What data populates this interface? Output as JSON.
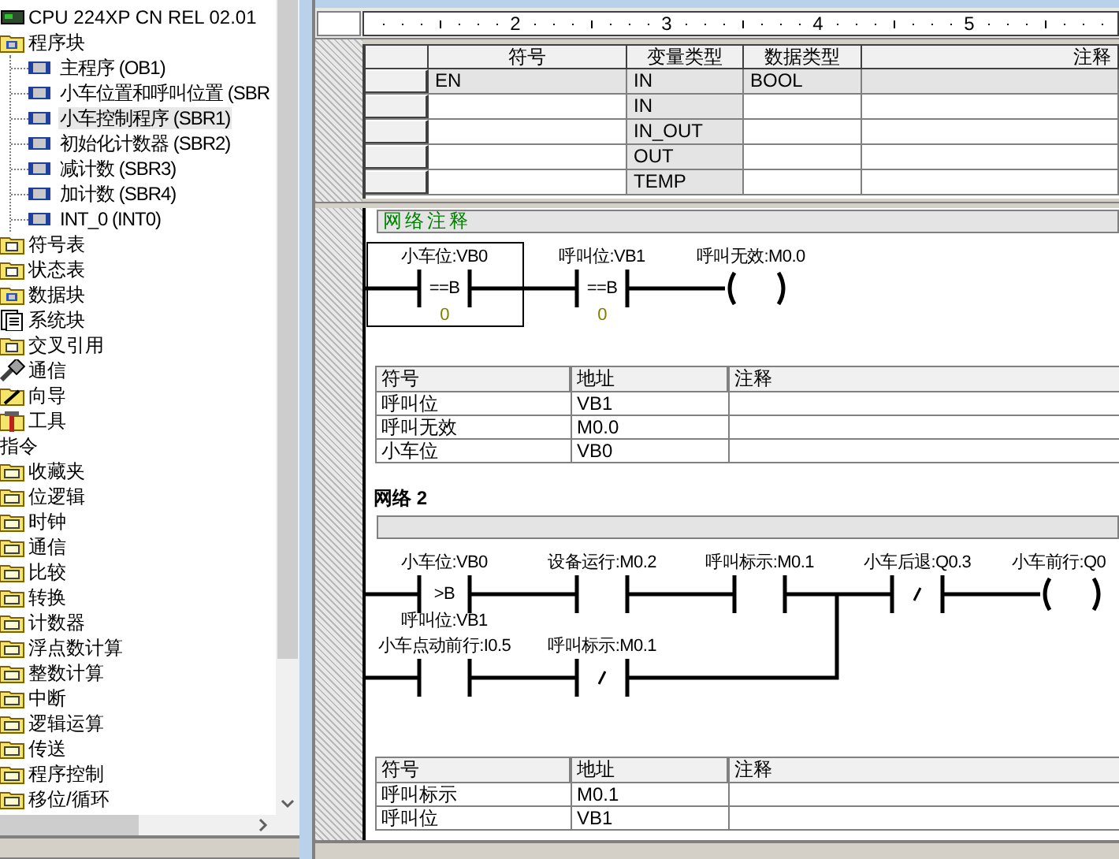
{
  "project_tree": [
    {
      "label": "CPU 224XP CN REL 02.01",
      "kind": "cpu"
    },
    {
      "label": "程序块",
      "kind": "block_folder",
      "children": [
        {
          "label": "主程序 (OB1)",
          "selected": false
        },
        {
          "label": "小车位置和呼叫位置 (SBR",
          "selected": false
        },
        {
          "label": "小车控制程序 (SBR1)",
          "selected": true
        },
        {
          "label": "初始化计数器 (SBR2)",
          "selected": false
        },
        {
          "label": "减计数 (SBR3)",
          "selected": false
        },
        {
          "label": "加计数 (SBR4)",
          "selected": false
        },
        {
          "label": "INT_0 (INT0)",
          "selected": false
        }
      ]
    },
    {
      "label": "符号表",
      "kind": "folder"
    },
    {
      "label": "状态表",
      "kind": "folder"
    },
    {
      "label": "数据块",
      "kind": "block_folder"
    },
    {
      "label": "系统块",
      "kind": "document"
    },
    {
      "label": "交叉引用",
      "kind": "folder"
    },
    {
      "label": "通信",
      "kind": "plug"
    },
    {
      "label": "向导",
      "kind": "wand"
    },
    {
      "label": "工具",
      "kind": "hammer"
    }
  ],
  "instructions": {
    "label": "指令",
    "items": [
      "收藏夹",
      "位逻辑",
      "时钟",
      "通信",
      "比较",
      "转换",
      "计数器",
      "浮点数计算",
      "整数计算",
      "中断",
      "逻辑运算",
      "传送",
      "程序控制",
      "移位/循环"
    ]
  },
  "ruler": {
    "labels": [
      "2",
      "3",
      "4",
      "5"
    ]
  },
  "variable_table": {
    "columns": [
      "符号",
      "变量类型",
      "数据类型",
      "注释"
    ],
    "rows": [
      {
        "symbol": "EN",
        "var_type": "IN",
        "data_type": "BOOL",
        "read_only": true
      },
      {
        "var_type": "IN",
        "read_only": false
      },
      {
        "var_type": "IN_OUT",
        "read_only": false
      },
      {
        "var_type": "OUT",
        "read_only": false
      },
      {
        "var_type": "TEMP",
        "read_only": false
      }
    ]
  },
  "networks": [
    {
      "comment": "网络注释",
      "rung": {
        "series": [
          {
            "kind": "compare",
            "operand": "小车位:VB0",
            "op": "==B",
            "value": "0",
            "selected": true
          },
          {
            "kind": "compare",
            "operand": "呼叫位:VB1",
            "op": "==B",
            "value": "0",
            "selected": false
          }
        ],
        "output": {
          "kind": "coil",
          "operand": "呼叫无效:M0.0"
        }
      },
      "symbols": {
        "columns": [
          "符号",
          "地址",
          "注释"
        ],
        "rows": [
          [
            "呼叫位",
            "VB1"
          ],
          [
            "呼叫无效",
            "M0.0"
          ],
          [
            "小车位",
            "VB0"
          ]
        ]
      }
    },
    {
      "title": "网络 2",
      "rung": {
        "series": [
          {
            "kind": "compare",
            "operand": "小车位:VB0",
            "op": ">B",
            "operand2": "呼叫位:VB1",
            "selected": false
          },
          {
            "kind": "no_contact",
            "operand": "设备运行:M0.2",
            "selected": false
          },
          {
            "kind": "no_contact",
            "operand": "呼叫标示:M0.1",
            "selected": false
          }
        ],
        "branch": [
          {
            "kind": "no_contact",
            "operand": "小车点动前行:I0.5",
            "selected": false
          },
          {
            "kind": "nc_contact",
            "operand": "呼叫标示:M0.1",
            "selected": false
          }
        ],
        "after_branch": [
          {
            "kind": "nc_contact",
            "operand": "小车后退:Q0.3",
            "selected": false
          }
        ],
        "output": {
          "kind": "coil",
          "operand": "小车前行:Q0"
        }
      },
      "symbols": {
        "columns": [
          "符号",
          "地址",
          "注释"
        ],
        "rows": [
          [
            "呼叫标示",
            "M0.1"
          ],
          [
            "呼叫位",
            "VB1"
          ]
        ]
      }
    }
  ]
}
